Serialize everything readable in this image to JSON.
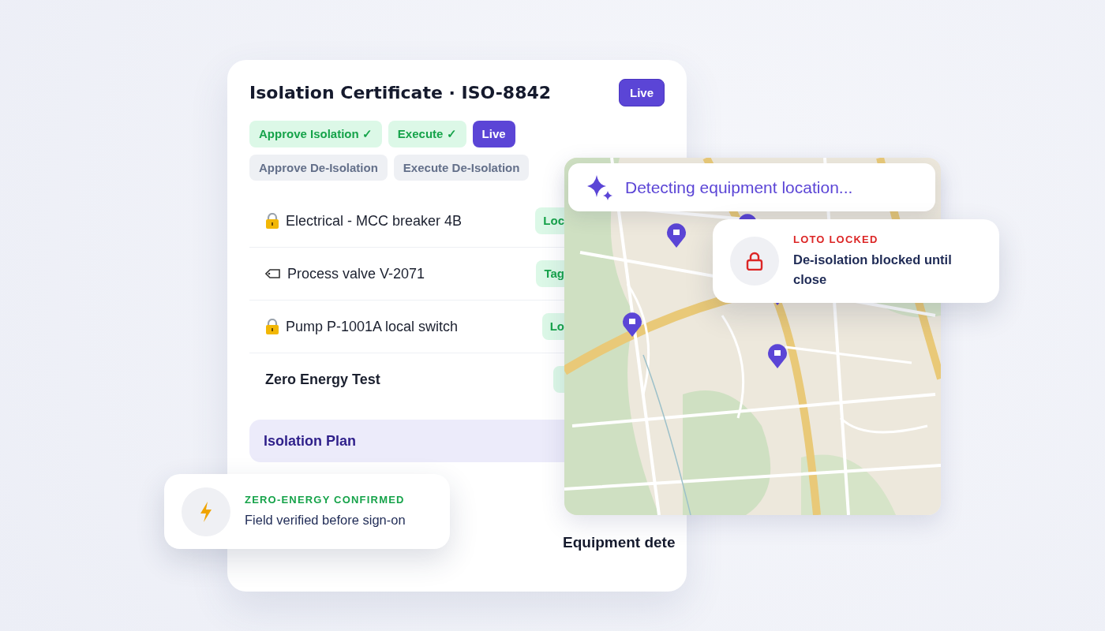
{
  "certificate": {
    "title": "Isolation Certificate · ISO-8842",
    "status": "Live"
  },
  "steps": [
    {
      "label": "Approve Isolation ✓",
      "done": true,
      "selected": false
    },
    {
      "label": "Execute ✓",
      "done": true,
      "selected": false
    },
    {
      "label": "Live",
      "done": false,
      "selected": true
    },
    {
      "label": "Approve De-Isolation",
      "done": false,
      "selected": false
    },
    {
      "label": "Execute De-Isolation",
      "done": false,
      "selected": false
    }
  ],
  "points": [
    {
      "kind": "lock",
      "name": "Electrical - MCC breaker 4B",
      "badge": "Loc"
    },
    {
      "kind": "tag",
      "name": "Process valve V-2071",
      "badge": "Tag"
    },
    {
      "kind": "lock",
      "name": "Pump P-1001A local switch",
      "badge": "Lo"
    },
    {
      "kind": "test",
      "name": "Zero Energy Test"
    }
  ],
  "plan": {
    "title": "Isolation Plan"
  },
  "map_caption": "Equipment dete",
  "detect_banner": "Detecting equipment location...",
  "alerts": [
    {
      "kind": "locked",
      "label": "LOTO LOCKED",
      "text": "De-isolation blocked until close"
    },
    {
      "kind": "energy",
      "label": "ZERO-ENERGY CONFIRMED",
      "text": "Field verified before sign-on"
    }
  ]
}
